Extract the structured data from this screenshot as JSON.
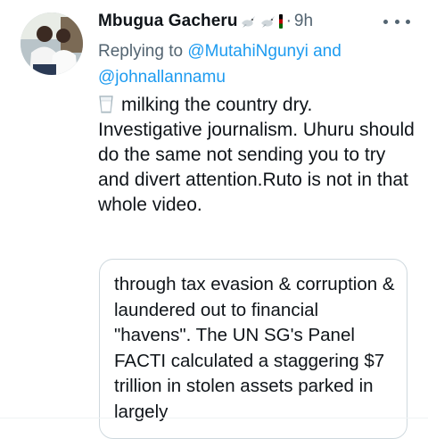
{
  "tweet": {
    "author_name": "Mbugua Gacheru",
    "separator": "·",
    "timestamp": "9h",
    "replying_prefix": "Replying to",
    "mention_1": "@MutahiNgunyi",
    "and_word": "and",
    "mention_2": "@johnallannamu",
    "text_line_1": "milking the country dry.",
    "text_rest": "Investigative journalism. Uhuru should do the same not sending you to try and divert attention.Ruto is not in that whole video.",
    "icons": [
      "avatar",
      "dove-emoji",
      "kenya-flag-emoji",
      "more-icon",
      "milk-glass-emoji"
    ]
  },
  "quoted_card": {
    "text": "through tax evasion & corruption & laundered out to financial \"havens\". The UN SG's Panel FACTI calculated  a staggering $7 trillion in stolen assets parked in largely"
  },
  "colors": {
    "primary_text": "#0f1419",
    "secondary_text": "#536471",
    "link": "#1d9bf0",
    "border": "#cfd9de"
  }
}
